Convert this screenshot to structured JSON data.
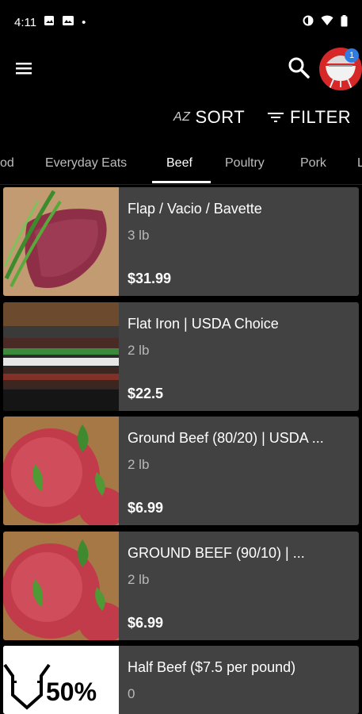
{
  "status_bar": {
    "time": "4:11",
    "dot": "•"
  },
  "app_bar": {
    "cart_count": "1"
  },
  "toolbar": {
    "sort_prefix": "AZ",
    "sort_label": "SORT",
    "filter_label": "FILTER"
  },
  "tabs": [
    {
      "label": "od"
    },
    {
      "label": "Everyday Eats"
    },
    {
      "label": "Beef"
    },
    {
      "label": "Poultry"
    },
    {
      "label": "Pork"
    },
    {
      "label": "L"
    }
  ],
  "active_tab": "Beef",
  "products": [
    {
      "name": "Flap / Vacio / Bavette",
      "weight": "3 lb",
      "price": "$31.99"
    },
    {
      "name": "Flat Iron | USDA Choice",
      "weight": "2 lb",
      "price": "$22.5"
    },
    {
      "name": "Ground Beef (80/20) | USDA ...",
      "weight": "2 lb",
      "price": "$6.99"
    },
    {
      "name": "GROUND BEEF (90/10) | ...",
      "weight": "2 lb",
      "price": "$6.99"
    },
    {
      "name": "Half Beef ($7.5 per pound)",
      "weight": "0",
      "price": "",
      "image_text": "50%"
    }
  ],
  "colors": {
    "background": "#000000",
    "card": "#424242",
    "cart_red": "#d62828",
    "badge_blue": "#2f7de1"
  }
}
